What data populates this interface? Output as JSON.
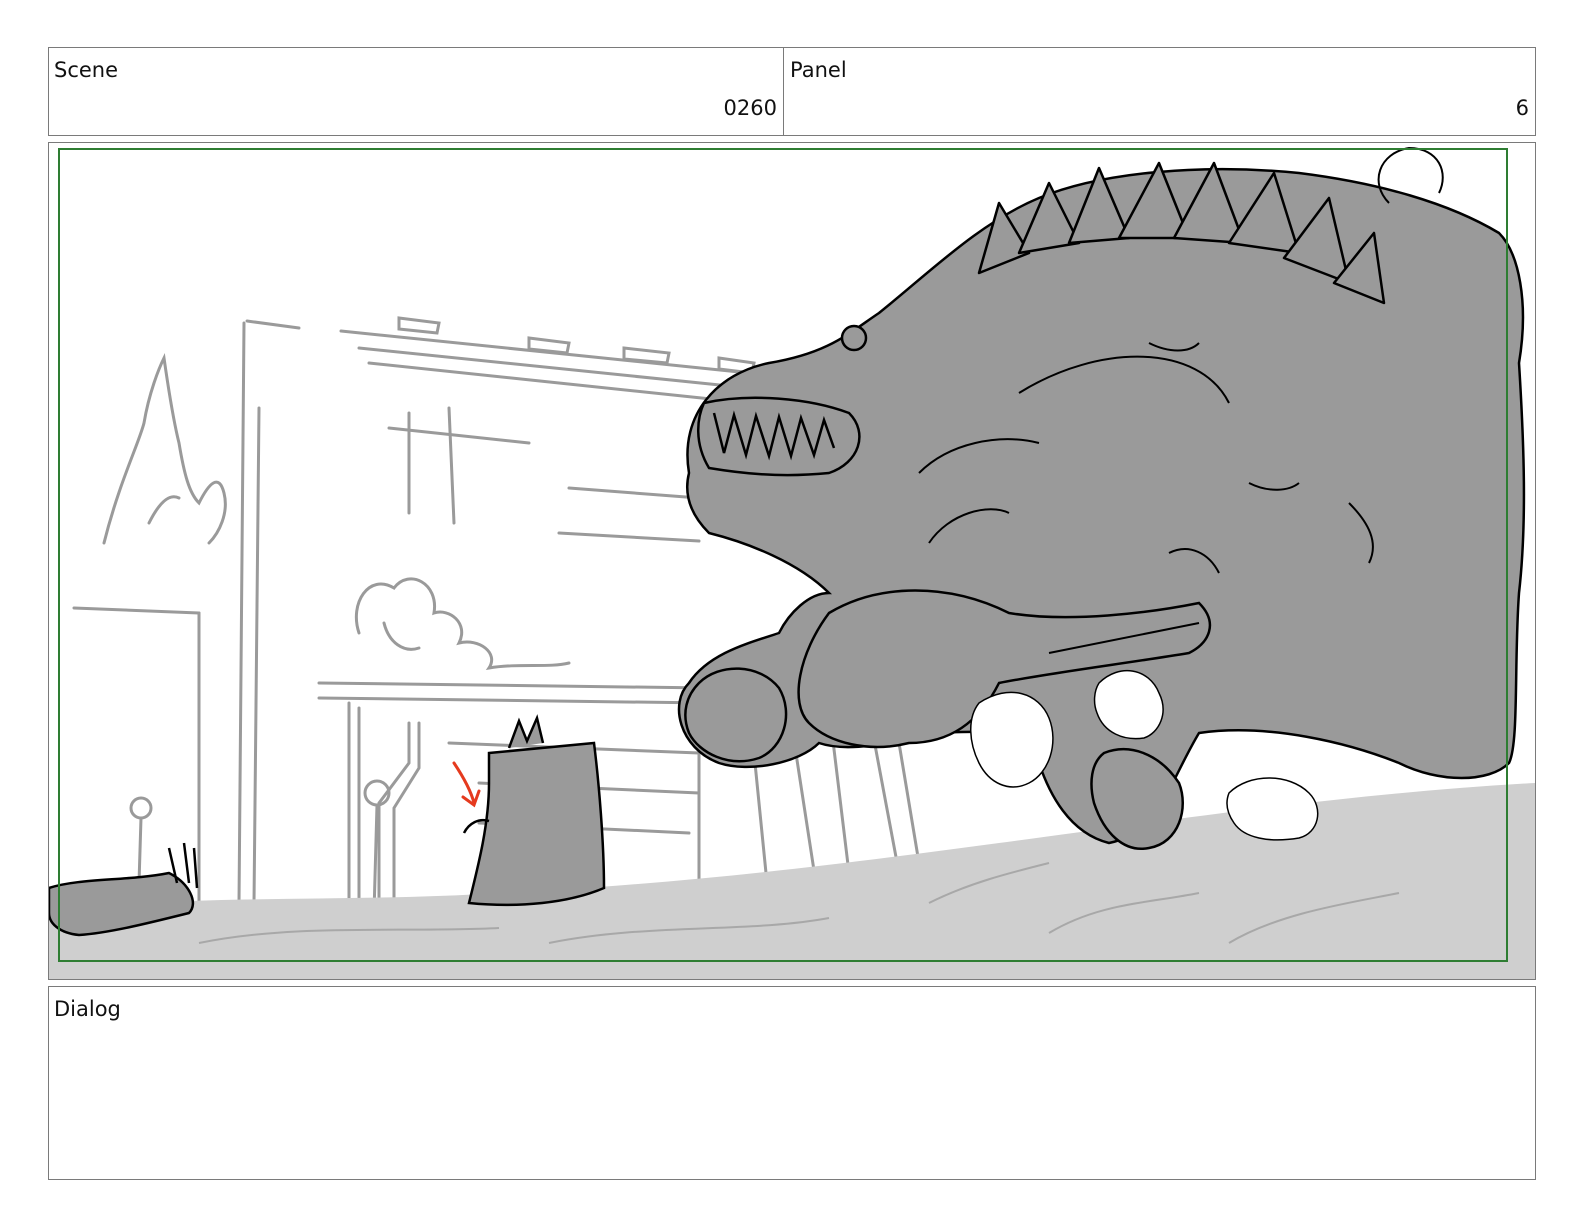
{
  "header": {
    "scene_label": "Scene",
    "scene_value": "0260",
    "panel_label": "Panel",
    "panel_value": "6"
  },
  "dialog": {
    "label": "Dialog"
  },
  "colors": {
    "safe_frame": "#2e7d32",
    "shadow_fill": "#9a9a9a",
    "ground_fill": "#cfcfcf",
    "arrow": "#e53a1e"
  }
}
